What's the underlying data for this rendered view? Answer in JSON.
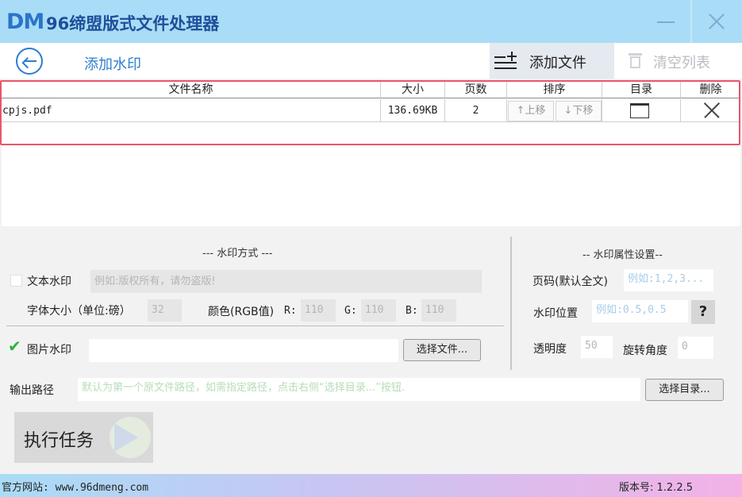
{
  "window": {
    "logo_text": "DM",
    "title": "96缔盟版式文件处理器"
  },
  "header": {
    "page_title": "添加水印",
    "add_file_label": "添加文件",
    "clear_list_label": "清空列表"
  },
  "table": {
    "columns": [
      "文件名称",
      "大小",
      "页数",
      "排序",
      "目录",
      "删除"
    ],
    "rows": [
      {
        "file_name": "cpjs.pdf",
        "size": "136.69KB",
        "pages": "2",
        "move_up": "↑上移",
        "move_down": "↓下移"
      }
    ]
  },
  "watermark_mode": {
    "section_title": "--- 水印方式 ---",
    "text_watermark": {
      "label": "文本水印",
      "checked": false,
      "placeholder": "例如:版权所有，请勿盗版!"
    },
    "font_size_label": "字体大小（单位:磅）",
    "font_size_value": "32",
    "color_label": "颜色(RGB值)",
    "r_label": "R:",
    "r_value": "110",
    "g_label": "G:",
    "g_value": "110",
    "b_label": "B:",
    "b_value": "110",
    "image_watermark": {
      "label": "图片水印",
      "checked": true,
      "value": "",
      "select_button": "选择文件..."
    }
  },
  "watermark_props": {
    "section_title": "-- 水印属性设置--",
    "pages_label": "页码(默认全文)",
    "pages_placeholder": "例如:1,2,3...",
    "position_label": "水印位置",
    "position_placeholder": "例如:0.5,0.5",
    "help_button": "?",
    "opacity_label": "透明度",
    "opacity_value": "50",
    "rotation_label": "旋转角度",
    "rotation_value": "0"
  },
  "output": {
    "label": "输出路径",
    "placeholder": "默认为第一个原文件路径，如需指定路径，点击右侧“选择目录...”按钮.",
    "select_button": "选择目录..."
  },
  "run": {
    "label": "执行任务"
  },
  "status": {
    "website": "官方网站:  www.96dmeng.com",
    "version": "版本号: 1.2.2.5"
  },
  "colors": {
    "titlebar": "#a9dcf6",
    "accent": "#2b7cd3",
    "table_highlight": "#e8566a",
    "check": "#2bb33a"
  }
}
